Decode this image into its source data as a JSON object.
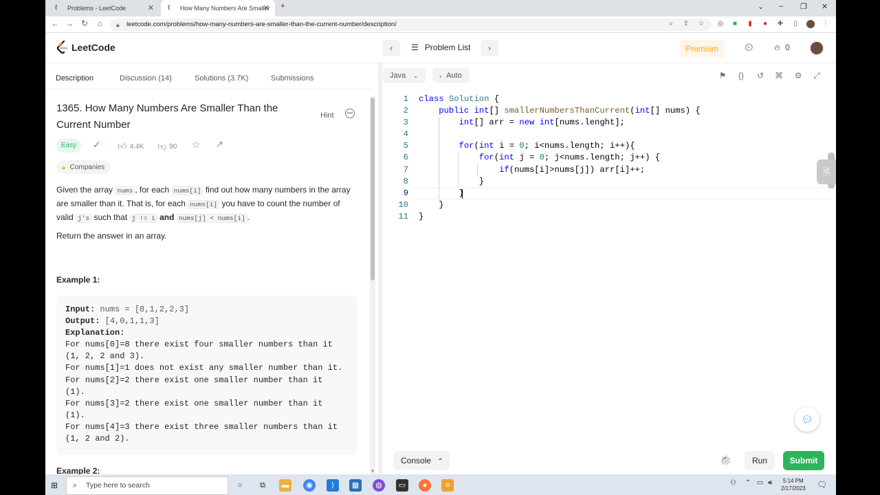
{
  "browser": {
    "tabs": [
      {
        "title": "Problems - LeetCode"
      },
      {
        "title": "How Many Numbers Are Smaller"
      }
    ],
    "url": "leetcode.com/problems/how-many-numbers-are-smaller-than-the-current-number/description/"
  },
  "header": {
    "logo": "LeetCode",
    "problem_list": "Problem List",
    "premium": "Premium",
    "streak": "0"
  },
  "tabs": {
    "description": "Description",
    "discussion": "Discussion (14)",
    "solutions": "Solutions (3.7K)",
    "submissions": "Submissions"
  },
  "problem": {
    "title": "1365. How Many Numbers Are Smaller Than the Current Number",
    "hint": "Hint",
    "difficulty": "Easy",
    "likes": "4.4K",
    "dislikes": "90",
    "companies": "Companies",
    "desc": {
      "p1a": "Given the array ",
      "c1": "nums",
      "p1b": ", for each ",
      "c2": "nums[i]",
      "p1c": " find out how many numbers in the array are smaller than it. That is, for each ",
      "c3": "nums[i]",
      "p1d": " you have to count the number of valid ",
      "c4": "j's",
      "p1e": " such that ",
      "c5": "j != i",
      "bold": "and",
      "c6": "nums[j] < nums[i]",
      "p1f": ".",
      "p2": "Return the answer in an array."
    },
    "example1": {
      "title": "Example 1:",
      "input_label": "Input:",
      "input_value": "nums = [8,1,2,2,3]",
      "output_label": "Output:",
      "output_value": "[4,0,1,1,3]",
      "explanation_label": "Explanation:",
      "lines": [
        "For nums[0]=8 there exist four smaller numbers than it",
        "(1, 2, 2 and 3).",
        "For nums[1]=1 does not exist any smaller number than it.",
        "For nums[2]=2 there exist one smaller number than it",
        "(1).",
        "For nums[3]=2 there exist one smaller number than it",
        "(1).",
        "For nums[4]=3 there exist three smaller numbers than it",
        "(1, 2 and 2)."
      ]
    },
    "example2_title": "Example 2:"
  },
  "editor": {
    "language": "Java",
    "mode": "Auto",
    "line_numbers": [
      "1",
      "2",
      "3",
      "4",
      "5",
      "6",
      "7",
      "8",
      "9",
      "10",
      "11"
    ]
  },
  "bottom": {
    "console": "Console",
    "run": "Run",
    "submit": "Submit"
  },
  "taskbar": {
    "search_placeholder": "Type here to search",
    "time": "5:14 PM",
    "date": "2/17/2023"
  },
  "colors": {
    "easy": "#2db55d",
    "submit": "#2db55d",
    "premium": "#f5a623"
  }
}
